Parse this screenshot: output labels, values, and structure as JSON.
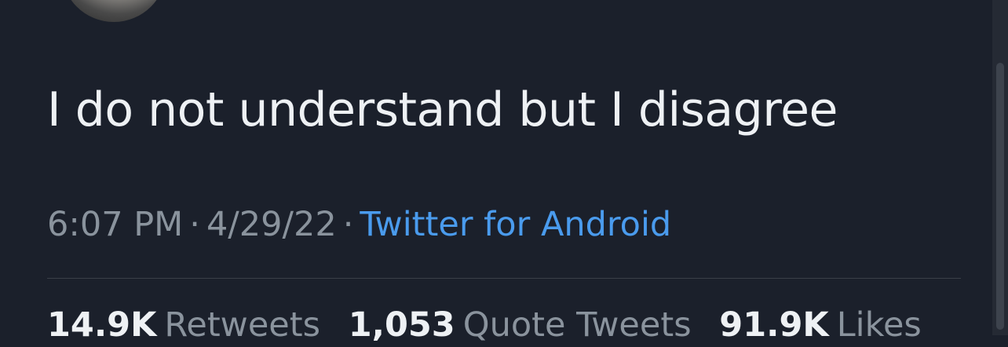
{
  "tweet": {
    "text": "I do not understand but I disagree",
    "time": "6:07 PM",
    "separator": "·",
    "date": "4/29/22",
    "source": "Twitter for Android"
  },
  "stats": [
    {
      "count": "14.9K",
      "label": "Retweets"
    },
    {
      "count": "1,053",
      "label": "Quote Tweets"
    },
    {
      "count": "91.9K",
      "label": "Likes"
    }
  ],
  "colors": {
    "background": "#1b202b",
    "text": "#eef1f4",
    "muted": "#8a939d",
    "link": "#4a9bed",
    "divider": "#3a3f48"
  }
}
